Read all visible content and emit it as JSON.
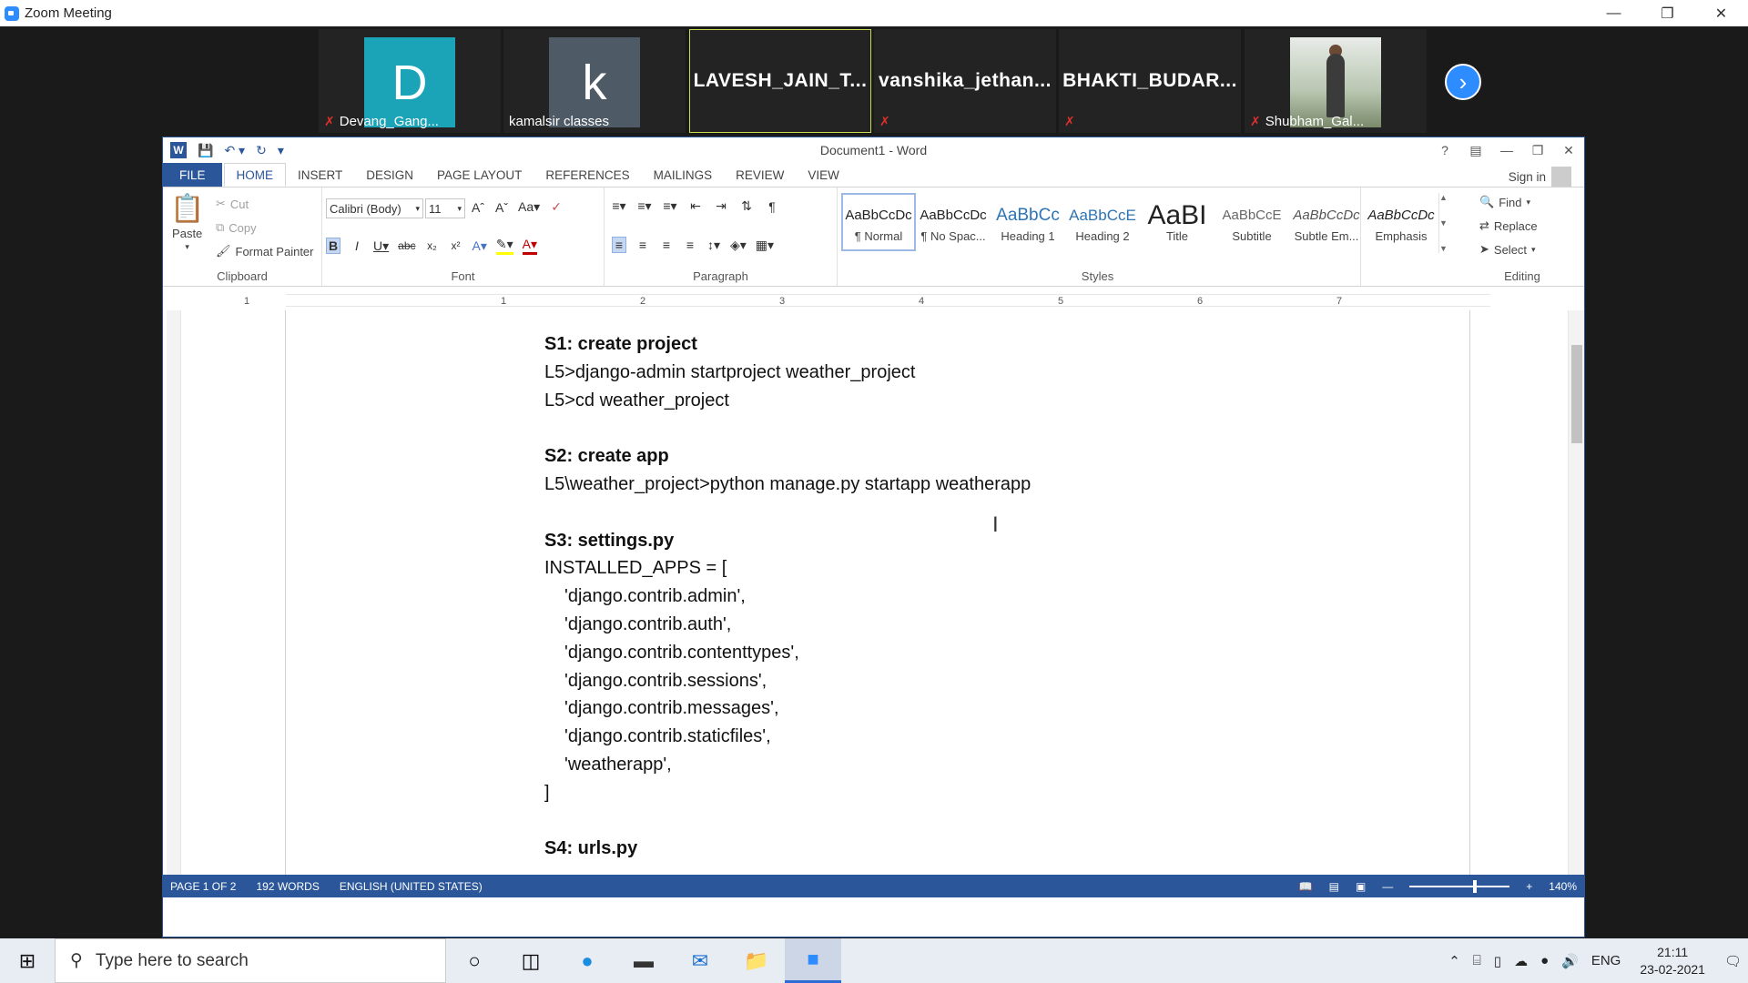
{
  "zoom": {
    "title": "Zoom Meeting",
    "participants": [
      {
        "type": "letter",
        "avatar": "D",
        "avatar_color": "#1ba3b8",
        "label": "Devang_Gang...",
        "muted": true
      },
      {
        "type": "letter",
        "avatar": "k",
        "avatar_color": "#4e5a66",
        "label": "kamalsir classes",
        "muted": false
      },
      {
        "type": "name",
        "name": "LAVESH_JAIN_T...",
        "active": true,
        "muted": false
      },
      {
        "type": "name",
        "name": "vanshika_jethan...",
        "muted": true
      },
      {
        "type": "name",
        "name": "BHAKTI_BUDAR...",
        "muted": true
      },
      {
        "type": "photo",
        "label": "Shubham_Gal...",
        "muted": true
      }
    ]
  },
  "word": {
    "title": "Document1 - Word",
    "tabs": [
      "FILE",
      "HOME",
      "INSERT",
      "DESIGN",
      "PAGE LAYOUT",
      "REFERENCES",
      "MAILINGS",
      "REVIEW",
      "VIEW"
    ],
    "active_tab": "HOME",
    "signin": "Sign in",
    "clipboard": {
      "paste": "Paste",
      "cut": "Cut",
      "copy": "Copy",
      "format_painter": "Format Painter",
      "label": "Clipboard"
    },
    "font": {
      "name": "Calibri (Body)",
      "size": "11",
      "label": "Font"
    },
    "paragraph_label": "Paragraph",
    "styles": [
      {
        "preview": "AaBbCcDc",
        "name": "¶ Normal"
      },
      {
        "preview": "AaBbCcDc",
        "name": "¶ No Spac..."
      },
      {
        "preview": "AaBbCc",
        "name": "Heading 1"
      },
      {
        "preview": "AaBbCcE",
        "name": "Heading 2"
      },
      {
        "preview": "AaBI",
        "name": "Title"
      },
      {
        "preview": "AaBbCcE",
        "name": "Subtitle"
      },
      {
        "preview": "AaBbCcDc",
        "name": "Subtle Em..."
      },
      {
        "preview": "AaBbCcDc",
        "name": "Emphasis"
      }
    ],
    "styles_label": "Styles",
    "editing": {
      "find": "Find",
      "replace": "Replace",
      "select": "Select",
      "label": "Editing"
    },
    "ruler_numbers": [
      "1",
      "1",
      "2",
      "3",
      "4",
      "5",
      "6",
      "7"
    ],
    "document_lines": [
      {
        "text": "S1: create project",
        "style": "h"
      },
      {
        "text": "L5>django-admin startproject weather_project",
        "style": ""
      },
      {
        "text": "L5>cd weather_project",
        "style": ""
      },
      {
        "text": "",
        "style": ""
      },
      {
        "text": "S2: create app",
        "style": "h"
      },
      {
        "text": "L5\\weather_project>python manage.py startapp weatherapp",
        "style": ""
      },
      {
        "text": "",
        "style": ""
      },
      {
        "text": "S3: settings.py",
        "style": "h"
      },
      {
        "text": "INSTALLED_APPS = [",
        "style": ""
      },
      {
        "text": "'django.contrib.admin',",
        "style": "ind"
      },
      {
        "text": "'django.contrib.auth',",
        "style": "ind"
      },
      {
        "text": "'django.contrib.contenttypes',",
        "style": "ind"
      },
      {
        "text": "'django.contrib.sessions',",
        "style": "ind"
      },
      {
        "text": "'django.contrib.messages',",
        "style": "ind"
      },
      {
        "text": "'django.contrib.staticfiles',",
        "style": "ind"
      },
      {
        "text": "'weatherapp',",
        "style": "ind"
      },
      {
        "text": "]",
        "style": ""
      },
      {
        "text": "",
        "style": ""
      },
      {
        "text": "S4: urls.py",
        "style": "h"
      }
    ],
    "status": {
      "page": "PAGE 1 OF 2",
      "words": "192 WORDS",
      "language": "ENGLISH (UNITED STATES)",
      "zoom": "140%"
    }
  },
  "taskbar": {
    "search_placeholder": "Type here to search",
    "language": "ENG",
    "time": "21:11",
    "date": "23-02-2021"
  }
}
